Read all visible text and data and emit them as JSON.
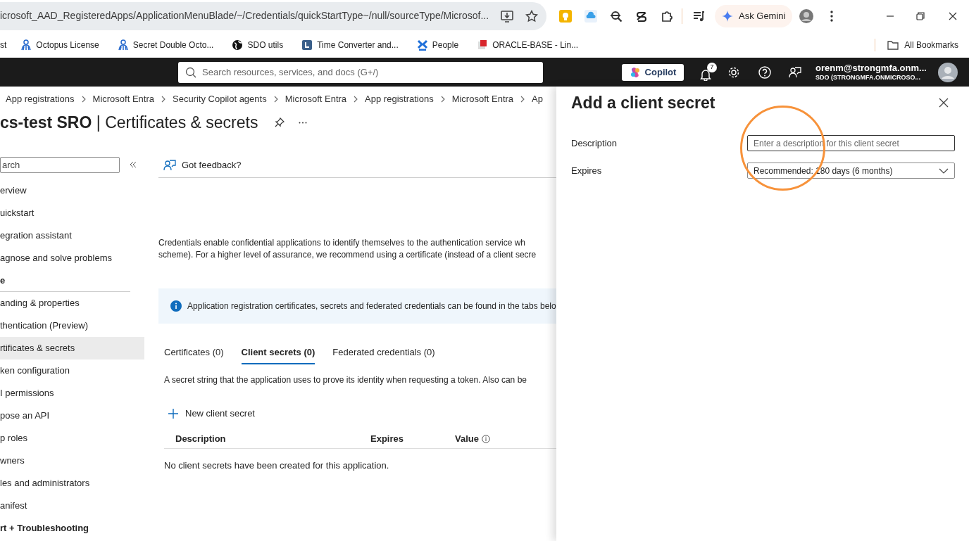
{
  "browser": {
    "url": "icrosoft_AAD_RegisteredApps/ApplicationMenuBlade/~/Credentials/quickStartType~/null/sourceType/Microsof...",
    "ask_gemini": "Ask Gemini"
  },
  "bookmarks": [
    {
      "label": "st"
    },
    {
      "label": "Octopus License"
    },
    {
      "label": "Secret Double Octo..."
    },
    {
      "label": "SDO utils"
    },
    {
      "label": "Time Converter and..."
    },
    {
      "label": "People"
    },
    {
      "label": "ORACLE-BASE - Lin..."
    }
  ],
  "all_bookmarks": "All Bookmarks",
  "portal_header": {
    "search_placeholder": "Search resources, services, and docs (G+/)",
    "copilot": "Copilot",
    "notifications_count": "7",
    "account_email": "orenm@strongmfa.onm...",
    "account_tenant": "SDO (STRONGMFA.ONMICROSO..."
  },
  "breadcrumb": [
    "App registrations",
    "Microsoft Entra",
    "Security Copilot agents",
    "Microsoft Entra",
    "App registrations",
    "Microsoft Entra",
    "Ap"
  ],
  "page_title": {
    "app": "cs-test SRO",
    "separator": "|",
    "section": "Certificates & secrets"
  },
  "sidebar": {
    "search_placeholder": "arch",
    "items": [
      {
        "kind": "item",
        "label": "erview",
        "selected": false
      },
      {
        "kind": "item",
        "label": "uickstart",
        "selected": false
      },
      {
        "kind": "item",
        "label": "egration assistant",
        "selected": false
      },
      {
        "kind": "item",
        "label": "agnose and solve problems",
        "selected": false
      },
      {
        "kind": "heading",
        "label": "e"
      },
      {
        "kind": "item",
        "label": "anding & properties",
        "selected": false
      },
      {
        "kind": "item",
        "label": "thentication (Preview)",
        "selected": false
      },
      {
        "kind": "item",
        "label": "rtificates & secrets",
        "selected": true
      },
      {
        "kind": "item",
        "label": "ken configuration",
        "selected": false
      },
      {
        "kind": "item",
        "label": "I permissions",
        "selected": false
      },
      {
        "kind": "item",
        "label": "pose an API",
        "selected": false
      },
      {
        "kind": "item",
        "label": "p roles",
        "selected": false
      },
      {
        "kind": "item",
        "label": "wners",
        "selected": false
      },
      {
        "kind": "item",
        "label": "les and administrators",
        "selected": false
      },
      {
        "kind": "item",
        "label": "anifest",
        "selected": false
      },
      {
        "kind": "heading",
        "label": "rt + Troubleshooting"
      }
    ]
  },
  "feedback": "Got feedback?",
  "intro": [
    "Credentials enable confidential applications to identify themselves to the authentication service wh",
    "scheme). For a higher level of assurance, we recommend using a certificate (instead of a client secre"
  ],
  "info_banner": "Application registration certificates, secrets and federated credentials can be found in the tabs belo",
  "tabs": [
    {
      "label": "Certificates (0)",
      "selected": false
    },
    {
      "label": "Client secrets (0)",
      "selected": true
    },
    {
      "label": "Federated credentials (0)",
      "selected": false
    }
  ],
  "tab_description": "A secret string that the application uses to prove its identity when requesting a token. Also can be",
  "new_button": "New client secret",
  "table": {
    "columns": [
      "Description",
      "Expires",
      "Value"
    ],
    "empty_message": "No client secrets have been created for this application."
  },
  "panel": {
    "title": "Add a client secret",
    "fields": [
      {
        "kind": "text",
        "label": "Description",
        "placeholder": "Enter a description for this client secret"
      },
      {
        "kind": "dropdown",
        "label": "Expires",
        "value": "Recommended: 180 days (6 months)"
      }
    ]
  }
}
